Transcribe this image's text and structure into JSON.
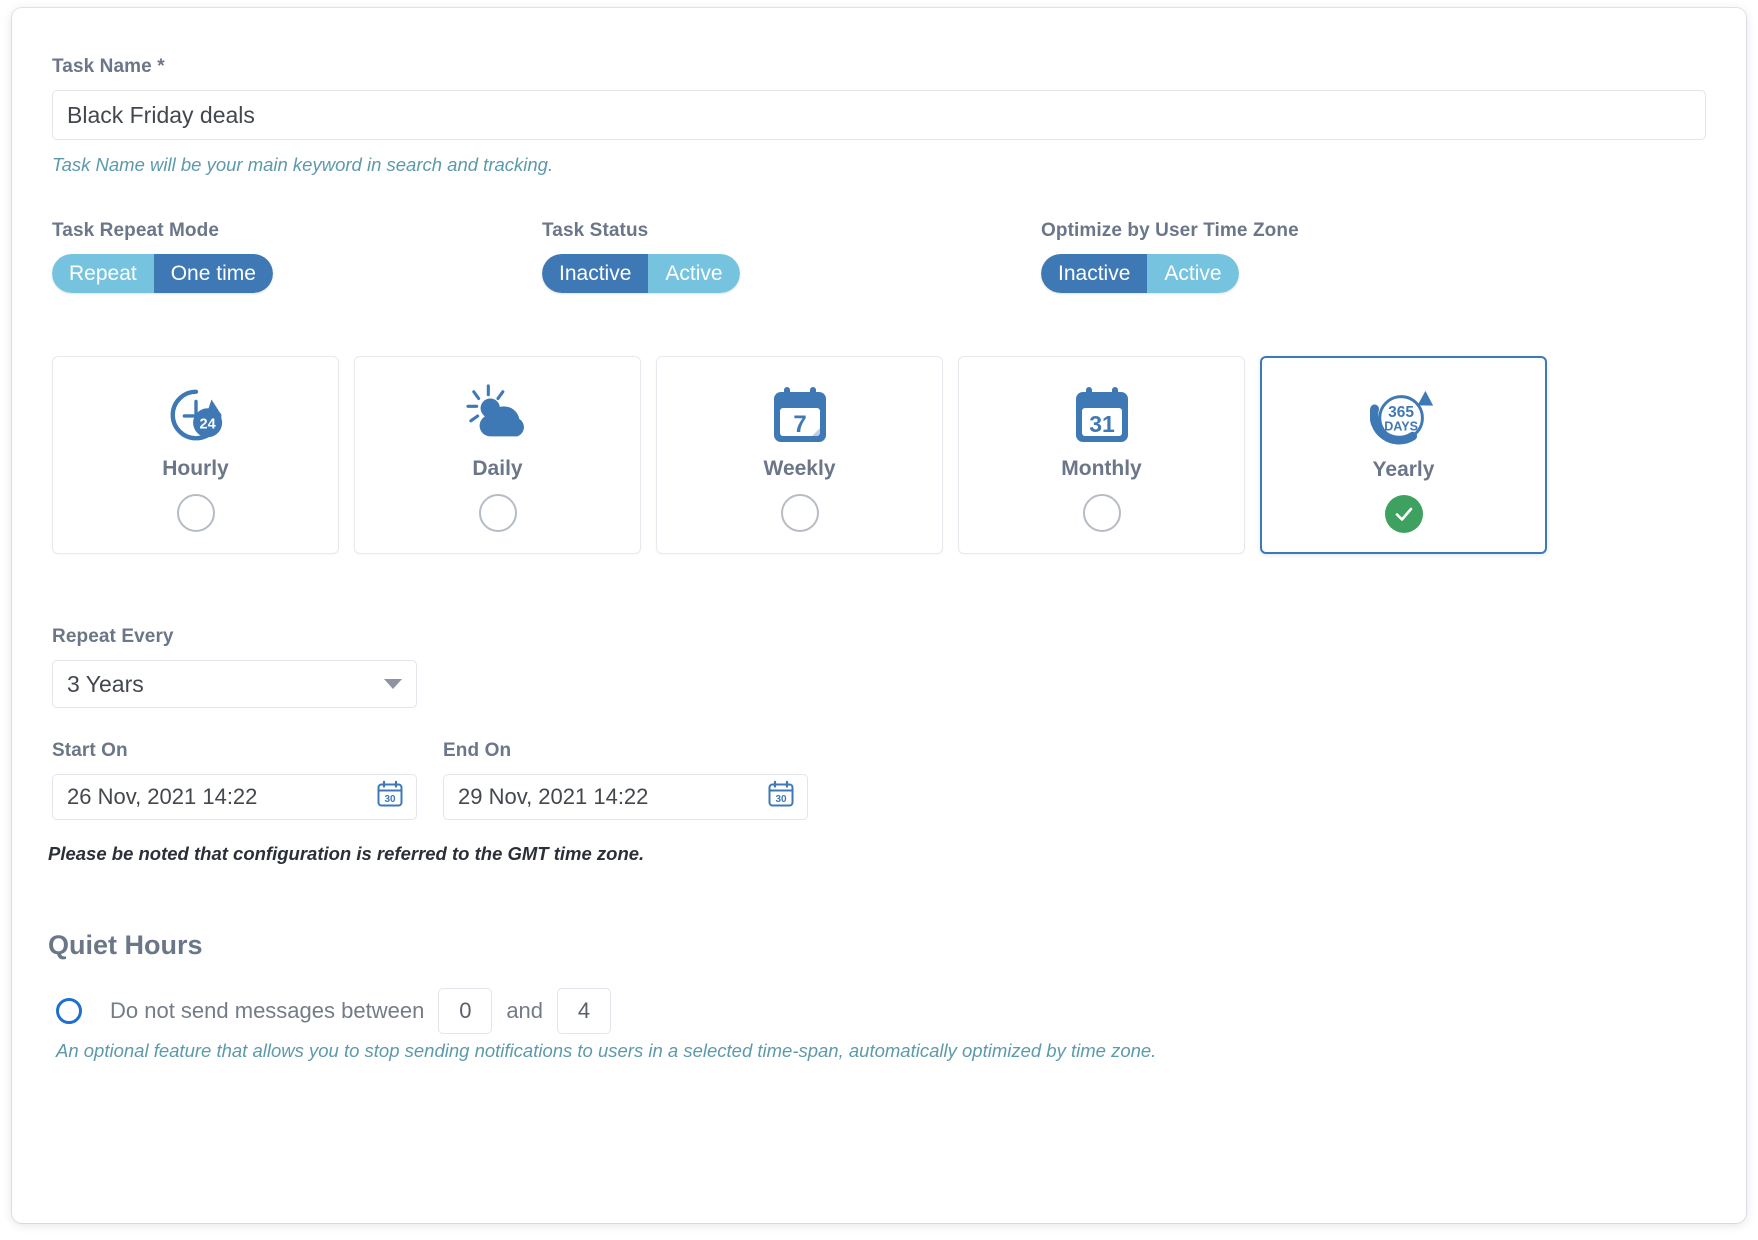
{
  "task_name": {
    "label": "Task Name *",
    "value": "Black Friday deals",
    "placeholder": "Task Name",
    "hint": "Task Name will be your main keyword in search and tracking."
  },
  "toggles": {
    "repeat_mode": {
      "label": "Task Repeat Mode",
      "options": [
        "Repeat",
        "One time"
      ],
      "selected": "Repeat"
    },
    "task_status": {
      "label": "Task Status",
      "options": [
        "Inactive",
        "Active"
      ],
      "selected": "Active"
    },
    "optimize_timezone": {
      "label": "Optimize by User Time Zone",
      "options": [
        "Inactive",
        "Active"
      ],
      "selected": "Active"
    }
  },
  "frequency": {
    "selected": "Yearly",
    "cards": [
      {
        "label": "Hourly",
        "icon": "clock-24-icon",
        "selected": false
      },
      {
        "label": "Daily",
        "icon": "sun-cloud-icon",
        "selected": false
      },
      {
        "label": "Weekly",
        "icon": "calendar-7-icon",
        "selected": false
      },
      {
        "label": "Monthly",
        "icon": "calendar-31-icon",
        "selected": false
      },
      {
        "label": "Yearly",
        "icon": "365-days-icon",
        "selected": true
      }
    ]
  },
  "repeat_every": {
    "label": "Repeat Every",
    "value": "3 Years"
  },
  "start_on": {
    "label": "Start On",
    "value": "26 Nov, 2021 14:22",
    "icon": "calendar-30-icon"
  },
  "end_on": {
    "label": "End On",
    "value": "29 Nov, 2021 14:22",
    "icon": "calendar-30-icon"
  },
  "gmt_note": "Please be noted that configuration is referred to the GMT time zone.",
  "quiet_hours": {
    "title": "Quiet Hours",
    "radio_selected": false,
    "text_before": "Do not send messages between",
    "from_value": "0",
    "conjunction": "and",
    "to_value": "4",
    "hint": "An optional feature that allows you to stop sending notifications to users in a selected time-span, automatically optimized by time zone."
  },
  "colors": {
    "accent_blue": "#3f79b5",
    "light_blue": "#76c3e0",
    "green_check": "#3fa160",
    "label_gray": "#6b7688",
    "hint_teal": "#5c9aab",
    "radio_blue": "#1f6fd0"
  }
}
